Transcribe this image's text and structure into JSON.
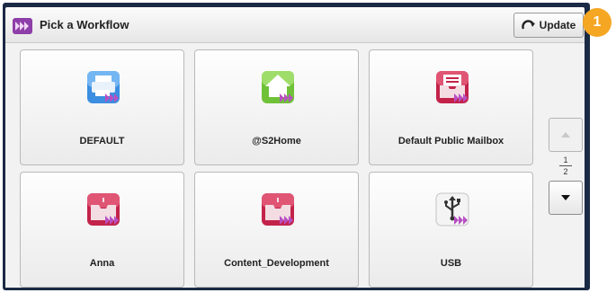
{
  "header": {
    "title": "Pick a Workflow",
    "update_label": "Update"
  },
  "callout": {
    "number": "1",
    "color": "#f5a623"
  },
  "tiles": [
    {
      "label": "DEFAULT",
      "icon": "printer-icon"
    },
    {
      "label": "@S2Home",
      "icon": "home-icon"
    },
    {
      "label": "Default Public Mailbox",
      "icon": "mailbox-icon"
    },
    {
      "label": "Anna",
      "icon": "folder-icon"
    },
    {
      "label": "Content_Development",
      "icon": "folder-icon"
    },
    {
      "label": "USB",
      "icon": "usb-icon"
    }
  ],
  "pager": {
    "current": "1",
    "total": "2"
  },
  "colors": {
    "accent": "#9b3fa8",
    "frame": "#1b2a45"
  }
}
